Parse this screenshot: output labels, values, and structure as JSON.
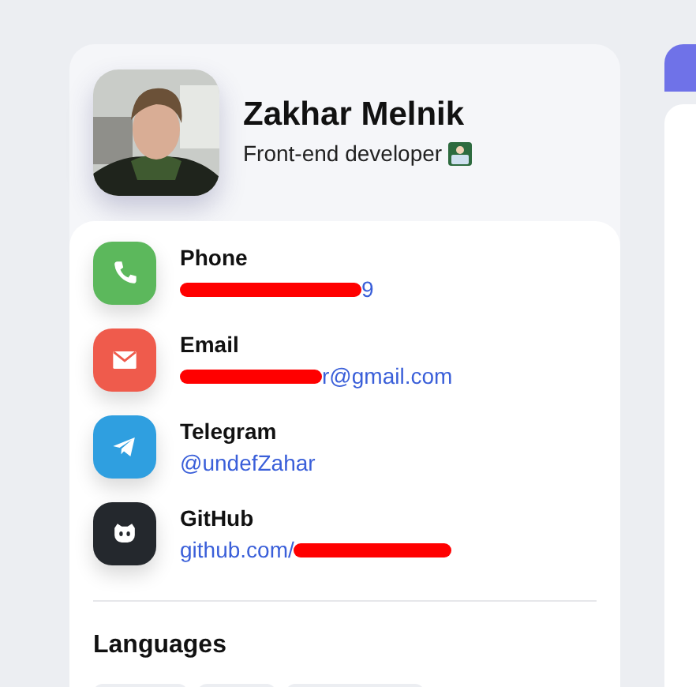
{
  "profile": {
    "name": "Zakhar Melnik",
    "role": "Front-end developer"
  },
  "contacts": [
    {
      "kind": "phone",
      "label": "Phone",
      "value": "9",
      "redacted": true
    },
    {
      "kind": "email",
      "label": "Email",
      "value": "r@gmail.com",
      "redacted": true
    },
    {
      "kind": "telegram",
      "label": "Telegram",
      "value": "@undefZahar",
      "redacted": false
    },
    {
      "kind": "github",
      "label": "GitHub",
      "value": "github.com/",
      "redacted": true
    }
  ],
  "languages": {
    "title": "Languages"
  }
}
